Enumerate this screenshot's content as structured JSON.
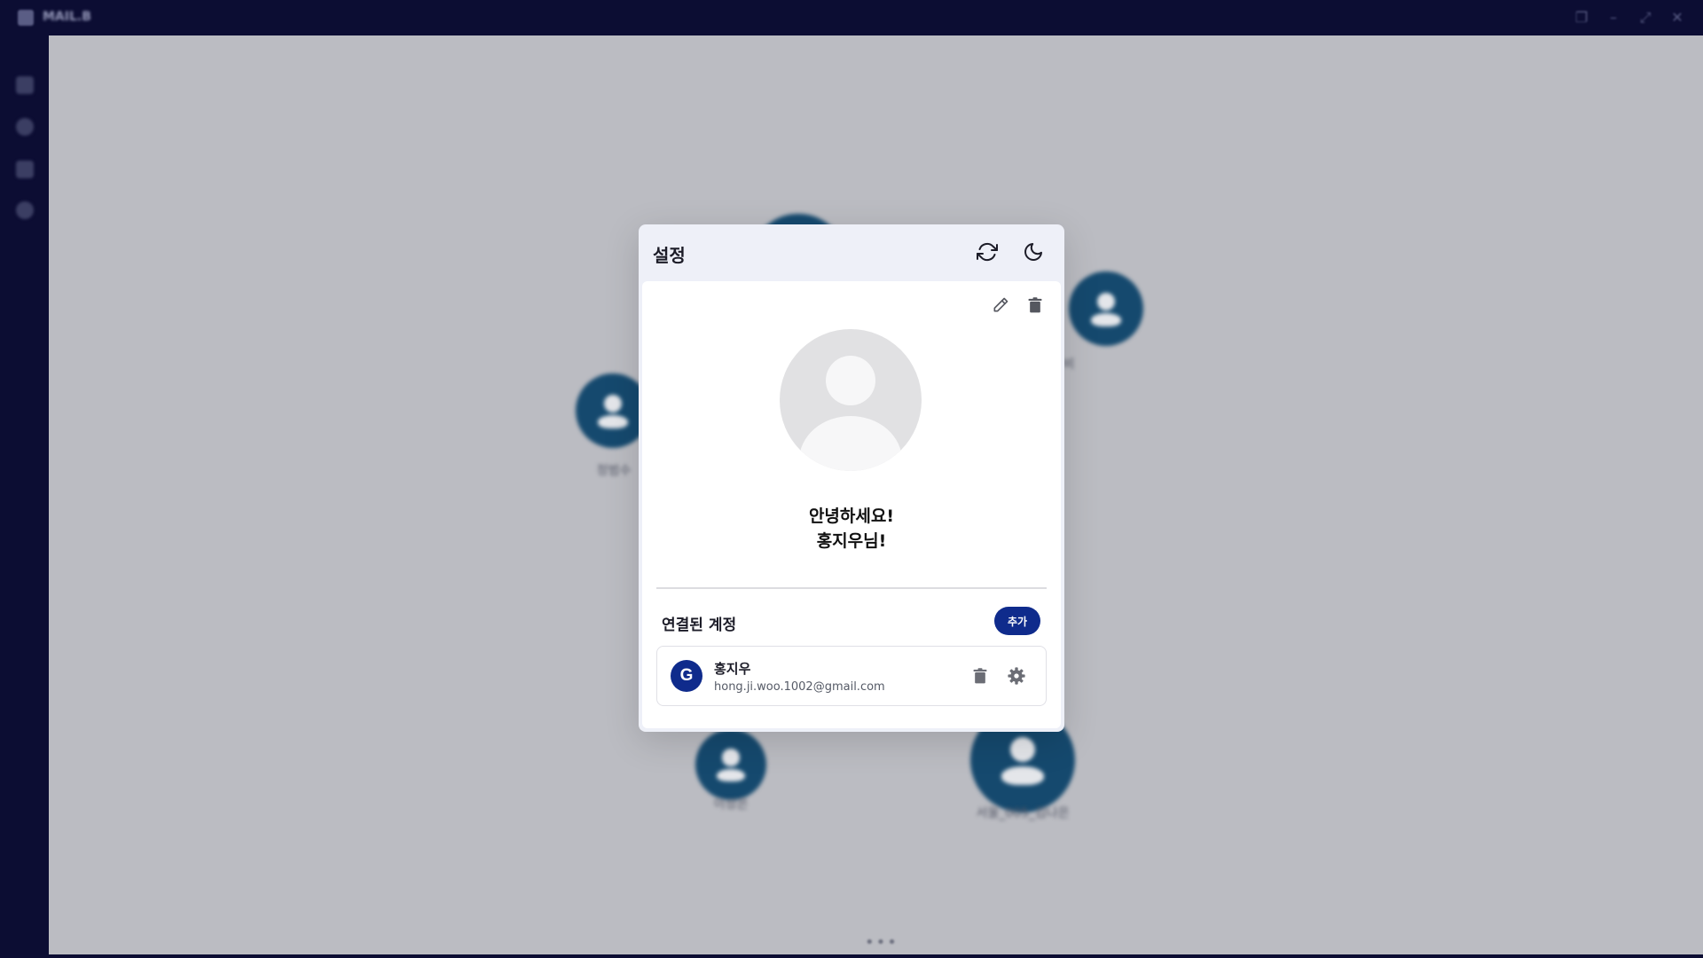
{
  "window": {
    "app_title": "MAIL.B"
  },
  "canvas": {
    "nodes": [
      {
        "label": "정범수"
      },
      {
        "label": "비"
      },
      {
        "label": "이성은"
      },
      {
        "label": "서울_005_김나은"
      }
    ]
  },
  "settings_modal": {
    "title": "설정",
    "greeting_line1": "안녕하세요!",
    "greeting_line2": "홍지우님!",
    "linked_accounts_title": "연결된 계정",
    "add_label": "추가",
    "accounts": [
      {
        "provider_letter": "G",
        "name": "홍지우",
        "email": "hong.ji.woo.1002@gmail.com"
      }
    ]
  },
  "colors": {
    "accent": "#0f2b8c",
    "sidebar": "#0c0d33",
    "canvas": "#bbbcc2",
    "node": "#15496e"
  },
  "icons": [
    "refresh-icon",
    "moon-icon",
    "edit-icon",
    "trash-icon",
    "gear-icon",
    "google-icon"
  ]
}
